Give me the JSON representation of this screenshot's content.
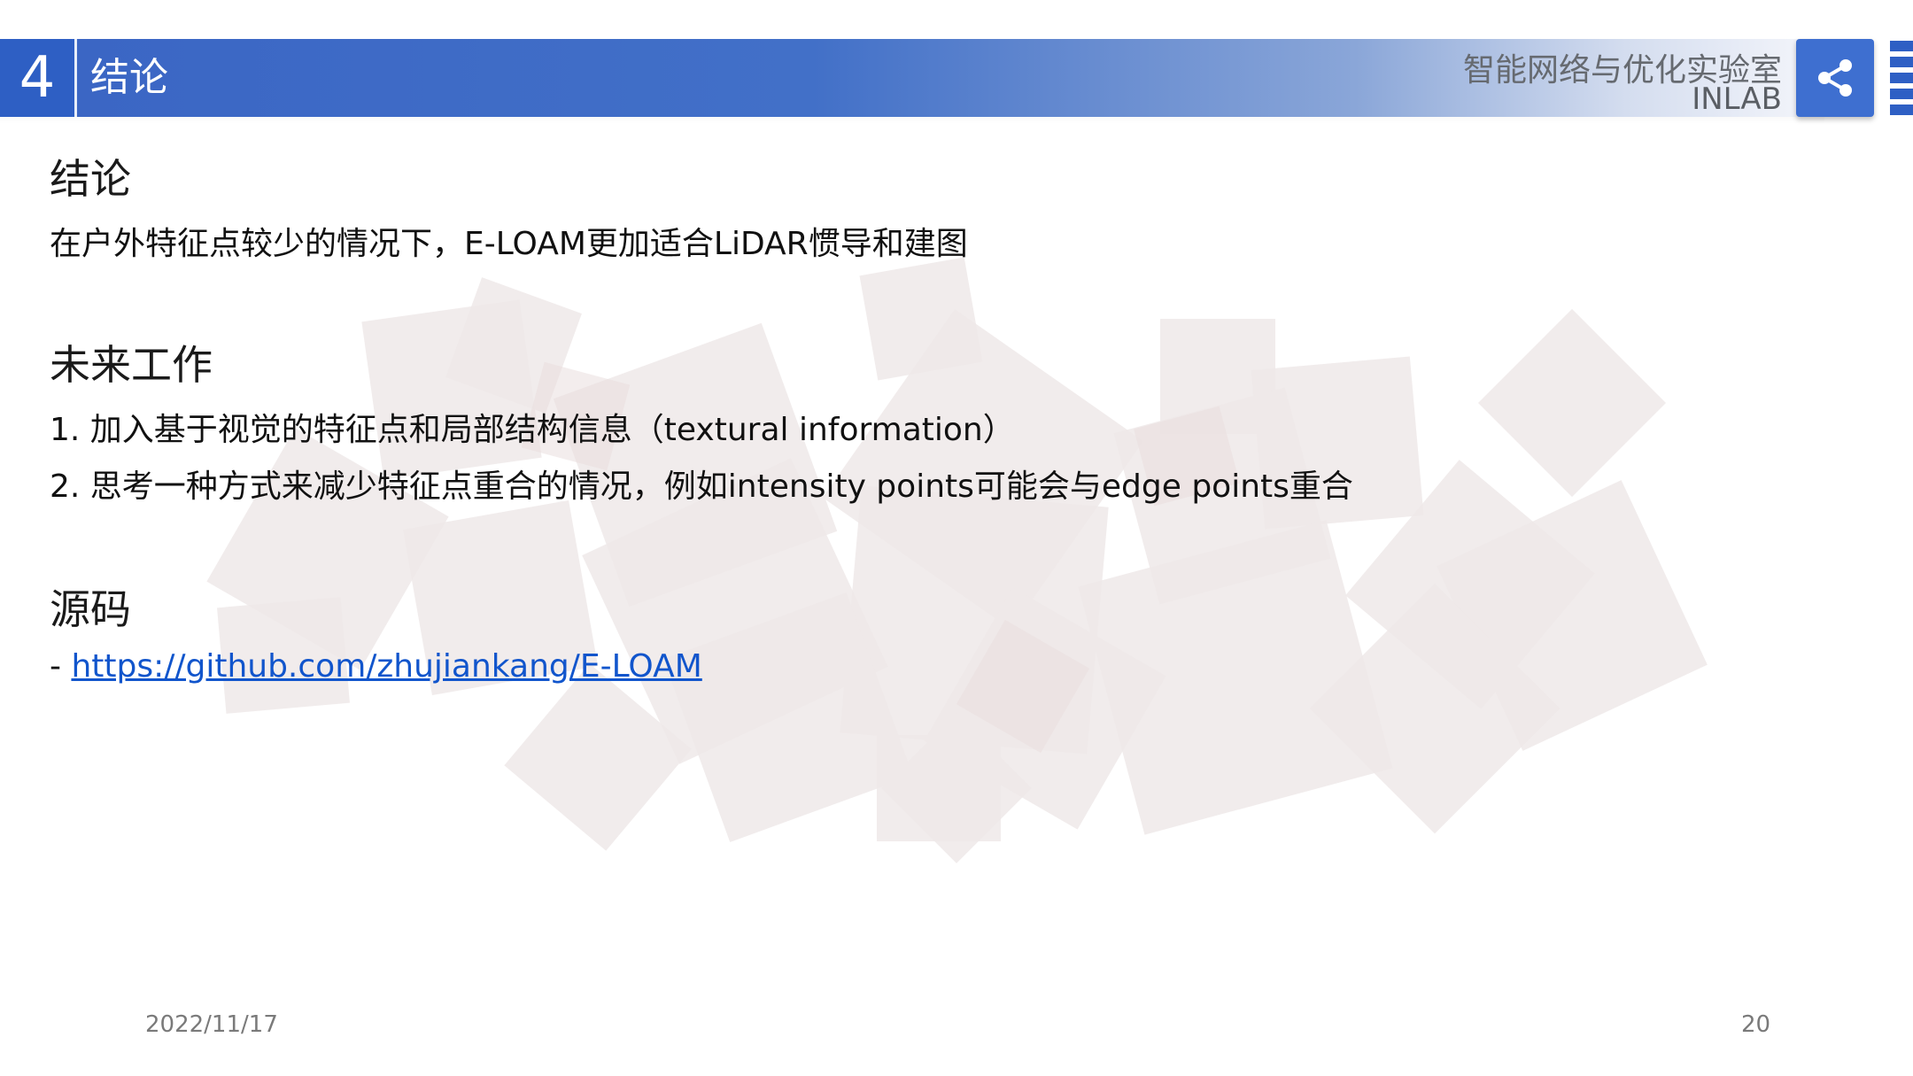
{
  "header": {
    "section_number": "4",
    "title": "结论",
    "lab_name": "智能网络与优化实验室",
    "lab_short": "INLAB",
    "share_icon": "share-icon"
  },
  "content": {
    "conclusion": {
      "heading": "结论",
      "text": "在户外特征点较少的情况下，E-LOAM更加适合LiDAR惯导和建图"
    },
    "future_work": {
      "heading": "未来工作",
      "items": [
        "1. 加入基于视觉的特征点和局部结构信息（textural information）",
        "2. 思考一种方式来减少特征点重合的情况，例如intensity points可能会与edge points重合"
      ]
    },
    "source": {
      "heading": "源码",
      "prefix": "- ",
      "link": "https://github.com/zhujiankang/E-LOAM"
    }
  },
  "footer": {
    "date": "2022/11/17",
    "page_number": "20"
  },
  "colors": {
    "header_blue": "#3a65c4",
    "section_box": "#2e5fc4",
    "link": "#1155cc",
    "bg_square": "#f2eeee"
  }
}
